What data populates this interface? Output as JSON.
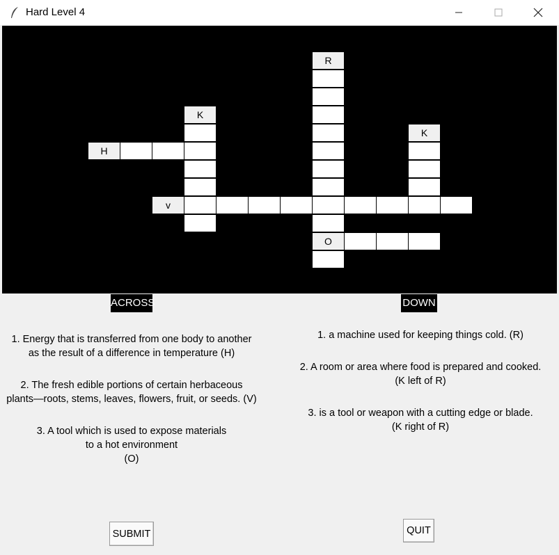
{
  "window": {
    "title": "Hard Level 4"
  },
  "grid": {
    "given_letters": {
      "H": "H",
      "K_left": "K",
      "R": "R",
      "K_right": "K",
      "V": "v",
      "O": "O"
    }
  },
  "across": {
    "header": "ACROSS",
    "clues": [
      {
        "line1": "1.  Energy that is transferred from one body to another",
        "line2": "as the result of a difference in temperature (H)"
      },
      {
        "line1": "2.  The fresh edible portions of certain herbaceous",
        "line2": "plants—roots, stems, leaves, flowers, fruit, or seeds. (V)"
      },
      {
        "line1": "3.  A tool which is used to expose materials",
        "line2": "to a hot environment",
        "line3": "(O)"
      }
    ]
  },
  "down": {
    "header": "DOWN",
    "clues": [
      {
        "line1": "1. a machine used for keeping things cold.  (R)"
      },
      {
        "line1": "2. A room or area where food is prepared and cooked.",
        "line2": "(K left of R)"
      },
      {
        "line1": "3. is a tool or weapon with a cutting edge or blade.",
        "line2": "(K right of R)"
      }
    ]
  },
  "buttons": {
    "submit": "SUBMIT",
    "quit": "QUIT"
  }
}
